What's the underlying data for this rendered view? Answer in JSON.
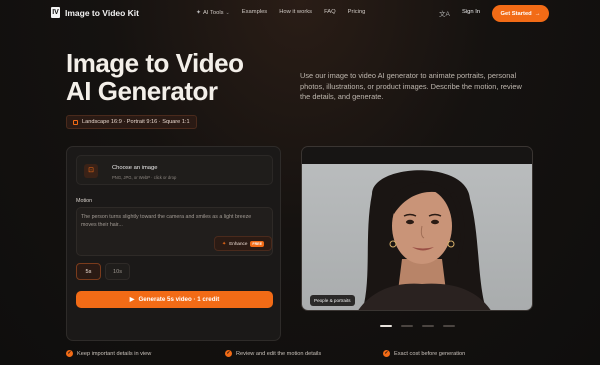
{
  "nav": {
    "brand": "Image to Video Kit",
    "logo_letters": "IV",
    "links": {
      "ai_tools": "AI Tools",
      "examples": "Examples",
      "how_it_works": "How it works",
      "faq": "FAQ",
      "pricing": "Pricing"
    },
    "sign_in": "Sign In",
    "get_started": "Get Started",
    "get_started_arrow": "→"
  },
  "hero": {
    "title_line1": "Image to Video",
    "title_line2": "AI Generator",
    "description": "Use our image to video AI generator to animate portraits, personal photos, illustrations, or product images. Describe the motion, review the details, and generate.",
    "aspect_ratios": "Landscape 16:9 · Portrait 9:16 · Square 1:1"
  },
  "form": {
    "upload_title": "Choose an image",
    "upload_hint": "PNG, JPG, or WebP · click or drop",
    "motion_label": "Motion",
    "motion_text": "The person turns slightly toward the camera and smiles as a light breeze moves their hair...",
    "enhance_label": "Enhance",
    "enhance_badge": "FREE",
    "duration_5": "5s",
    "duration_10": "10s",
    "generate_label": "Generate 5s video · 1 credit",
    "generate_icon": "▶"
  },
  "preview": {
    "label": "People & portraits",
    "active_slide": 1,
    "slides": 4
  },
  "features": [
    "Keep important details in view",
    "Review and edit the motion details",
    "Exact cost before generation"
  ],
  "colors": {
    "accent": "#f26b16",
    "background": "#151210",
    "card": "#1b1918"
  },
  "icons": {
    "sparkle": "sparkle-icon",
    "translate": "translate-icon",
    "image": "image-icon",
    "play": "play-icon",
    "check": "check-icon",
    "aspect": "aspect-ratio-icon"
  }
}
